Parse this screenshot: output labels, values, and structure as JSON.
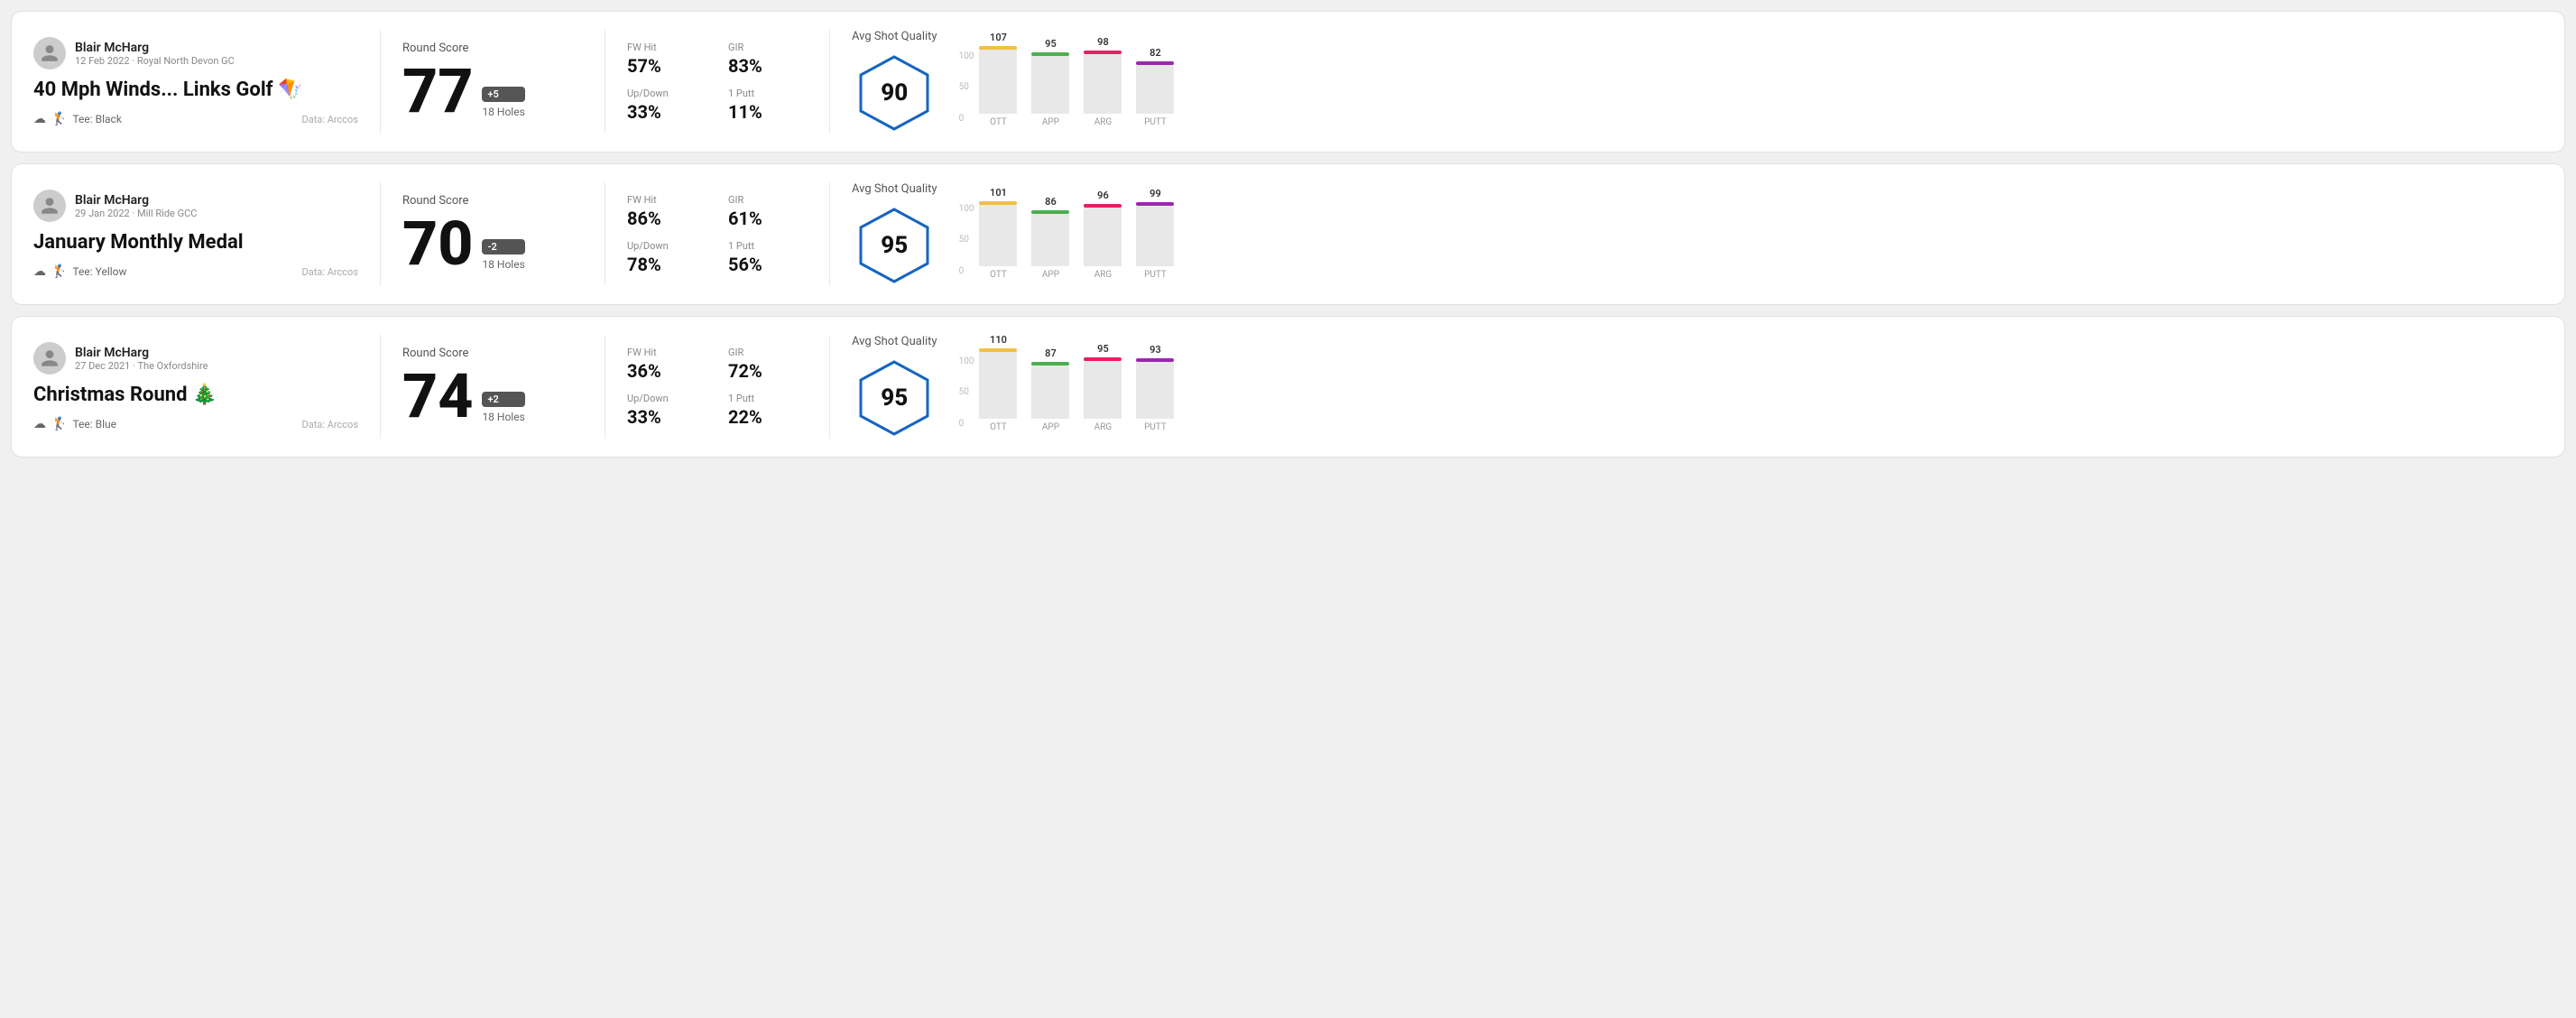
{
  "rounds": [
    {
      "id": "round-1",
      "user": {
        "name": "Blair McHarg",
        "date_course": "12 Feb 2022 · Royal North Devon GC"
      },
      "title": "40 Mph Winds... Links Golf 🪁",
      "tee": "Black",
      "data_source": "Data: Arccos",
      "score": {
        "number": "77",
        "diff": "+5",
        "holes": "18 Holes"
      },
      "stats": {
        "fw_hit_label": "FW Hit",
        "fw_hit_value": "57%",
        "gir_label": "GIR",
        "gir_value": "83%",
        "updown_label": "Up/Down",
        "updown_value": "33%",
        "oneputt_label": "1 Putt",
        "oneputt_value": "11%"
      },
      "quality": {
        "label": "Avg Shot Quality",
        "score": "90"
      },
      "chart": {
        "bars": [
          {
            "label": "OTT",
            "value": 107,
            "color": "#f0c040",
            "height": 75
          },
          {
            "label": "APP",
            "value": 95,
            "color": "#4caf50",
            "height": 68
          },
          {
            "label": "ARG",
            "value": 98,
            "color": "#e91e63",
            "height": 70
          },
          {
            "label": "PUTT",
            "value": 82,
            "color": "#9c27b0",
            "height": 58
          }
        ]
      }
    },
    {
      "id": "round-2",
      "user": {
        "name": "Blair McHarg",
        "date_course": "29 Jan 2022 · Mill Ride GCC"
      },
      "title": "January Monthly Medal",
      "tee": "Yellow",
      "data_source": "Data: Arccos",
      "score": {
        "number": "70",
        "diff": "-2",
        "holes": "18 Holes"
      },
      "stats": {
        "fw_hit_label": "FW Hit",
        "fw_hit_value": "86%",
        "gir_label": "GIR",
        "gir_value": "61%",
        "updown_label": "Up/Down",
        "updown_value": "78%",
        "oneputt_label": "1 Putt",
        "oneputt_value": "56%"
      },
      "quality": {
        "label": "Avg Shot Quality",
        "score": "95"
      },
      "chart": {
        "bars": [
          {
            "label": "OTT",
            "value": 101,
            "color": "#f0c040",
            "height": 72
          },
          {
            "label": "APP",
            "value": 86,
            "color": "#4caf50",
            "height": 62
          },
          {
            "label": "ARG",
            "value": 96,
            "color": "#e91e63",
            "height": 69
          },
          {
            "label": "PUTT",
            "value": 99,
            "color": "#9c27b0",
            "height": 71
          }
        ]
      }
    },
    {
      "id": "round-3",
      "user": {
        "name": "Blair McHarg",
        "date_course": "27 Dec 2021 · The Oxfordshire"
      },
      "title": "Christmas Round 🎄",
      "tee": "Blue",
      "data_source": "Data: Arccos",
      "score": {
        "number": "74",
        "diff": "+2",
        "holes": "18 Holes"
      },
      "stats": {
        "fw_hit_label": "FW Hit",
        "fw_hit_value": "36%",
        "gir_label": "GIR",
        "gir_value": "72%",
        "updown_label": "Up/Down",
        "updown_value": "33%",
        "oneputt_label": "1 Putt",
        "oneputt_value": "22%"
      },
      "quality": {
        "label": "Avg Shot Quality",
        "score": "95"
      },
      "chart": {
        "bars": [
          {
            "label": "OTT",
            "value": 110,
            "color": "#f0c040",
            "height": 78
          },
          {
            "label": "APP",
            "value": 87,
            "color": "#4caf50",
            "height": 63
          },
          {
            "label": "ARG",
            "value": 95,
            "color": "#e91e63",
            "height": 68
          },
          {
            "label": "PUTT",
            "value": 93,
            "color": "#9c27b0",
            "height": 67
          }
        ]
      }
    }
  ],
  "labels": {
    "round_score": "Round Score",
    "avg_shot_quality": "Avg Shot Quality",
    "data_arccos": "Data: Arccos",
    "y_axis": [
      "100",
      "50",
      "0"
    ]
  }
}
